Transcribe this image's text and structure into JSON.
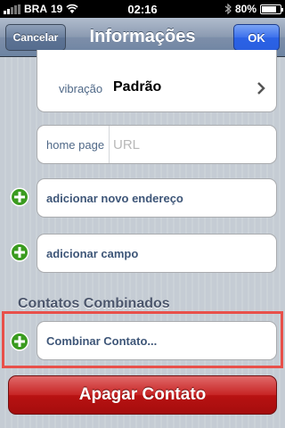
{
  "status_bar": {
    "carrier": "BRA",
    "network": "19",
    "time": "02:16",
    "battery": "80%",
    "battery_level": 0.8
  },
  "nav": {
    "cancel_label": "Cancelar",
    "title": "Informações",
    "ok_label": "OK"
  },
  "vibration": {
    "label": "vibração",
    "value": "Padrão"
  },
  "homepage": {
    "label": "home page",
    "placeholder": "URL"
  },
  "add_address_label": "adicionar novo endereço",
  "add_field_label": "adicionar campo",
  "linked_section": {
    "header": "Contatos Combinados",
    "link_label": "Combinar Contato..."
  },
  "delete_label": "Apagar Contato",
  "colors": {
    "nav_bar": "#6d84a2",
    "ok_button": "#2b62e6",
    "delete_button": "#b81212",
    "add_icon": "#3a9b1f",
    "highlight": "#e8504a"
  }
}
